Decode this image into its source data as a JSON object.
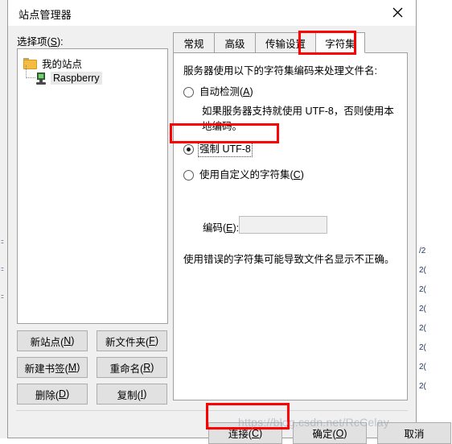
{
  "window": {
    "title": "站点管理器",
    "close_icon": "close-icon"
  },
  "left_pane": {
    "select_label": "选择项(S):",
    "tree": {
      "root": {
        "label": "我的站点",
        "icon": "folder-icon"
      },
      "children": [
        {
          "label": "Raspberry",
          "icon": "server-icon",
          "selected": true
        }
      ]
    },
    "buttons": [
      {
        "label": "新站点(N)",
        "accel": "N"
      },
      {
        "label": "新文件夹(F)",
        "accel": "F"
      },
      {
        "label": "新建书签(M)",
        "accel": "M"
      },
      {
        "label": "重命名(R)",
        "accel": "R"
      },
      {
        "label": "删除(D)",
        "accel": "D"
      },
      {
        "label": "复制(I)",
        "accel": "I"
      }
    ]
  },
  "tabs": [
    {
      "label": "常规",
      "active": false
    },
    {
      "label": "高级",
      "active": false
    },
    {
      "label": "传输设置",
      "active": false
    },
    {
      "label": "字符集",
      "active": true
    }
  ],
  "charset_panel": {
    "intro": "服务器使用以下的字符集编码来处理文件名:",
    "options": [
      {
        "label": "自动检测(A)",
        "accel": "A",
        "checked": false,
        "hint": "如果服务器支持就使用 UTF-8，否则使用本地编码。"
      },
      {
        "label": "强制 UTF-8",
        "checked": true,
        "focused": true
      },
      {
        "label": "使用自定义的字符集(C)",
        "accel": "C",
        "checked": false
      }
    ],
    "encoding_field": {
      "label": "编码(E):",
      "accel": "E",
      "value": "",
      "placeholder": "",
      "disabled": true
    },
    "warning": "使用错误的字符集可能导致文件名显示不正确。"
  },
  "footer": {
    "buttons": [
      {
        "label": "连接(C)",
        "accel": "C",
        "highlighted": true
      },
      {
        "label": "确定(O)",
        "accel": "O",
        "highlighted": false
      },
      {
        "label": "取消",
        "accel": "",
        "highlighted": false
      }
    ]
  },
  "annotations": {
    "color": "#ff0000",
    "boxes": [
      "tab-charset",
      "radio-force-utf8",
      "connect-button"
    ]
  },
  "watermark": {
    "text": "https://blog.csdn.net/RcCelay"
  },
  "background": {
    "left_ticks": [
      ":::",
      ":::",
      ":::"
    ],
    "right_lines": [
      "/2",
      "2(",
      "2(",
      "2(",
      "2(",
      "2(",
      "2(",
      "2(",
      "2("
    ]
  }
}
